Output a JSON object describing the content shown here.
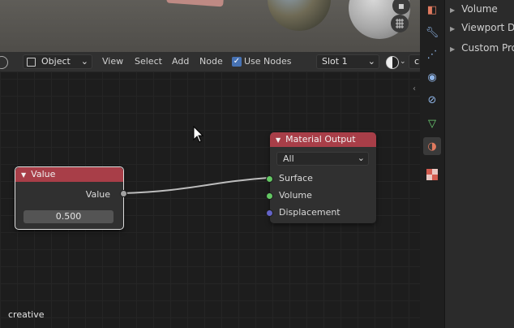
{
  "header": {
    "mode_label": "Object",
    "menu": [
      "View",
      "Select",
      "Add",
      "Node"
    ],
    "use_nodes_label": "Use Nodes",
    "slot_label": "Slot 1",
    "partial_label": "c"
  },
  "nodes": {
    "value": {
      "title": "Value",
      "output_label": "Value",
      "field_value": "0.500"
    },
    "material_output": {
      "title": "Material Output",
      "target": "All",
      "inputs": [
        "Surface",
        "Volume",
        "Displacement"
      ]
    }
  },
  "canvas_caption": "creative",
  "properties": {
    "sections": [
      "Volume",
      "Viewport Di",
      "Custom Pro"
    ]
  },
  "colors": {
    "node_header": "#a83e48",
    "socket_shader": "#63c763",
    "socket_vector": "#6363c7",
    "socket_value": "#a1a1a1",
    "accent": "#4772b3"
  }
}
